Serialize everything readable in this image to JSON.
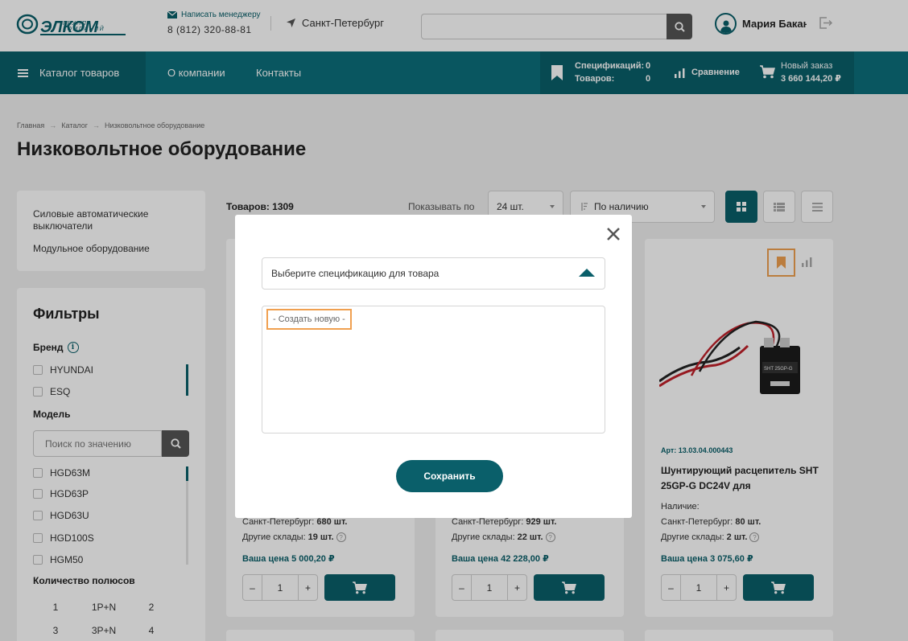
{
  "header": {
    "logo_sub": "ГРУППА КОМПАНИЙ",
    "logo_text": "ЭЛКОМ",
    "write_manager": "Написать менеджеру",
    "phone": "8 (812) 320-88-81",
    "city": "Санкт-Петербург",
    "search_placeholder": "",
    "user_name": "Мария Бакан"
  },
  "nav": {
    "catalog": "Каталог товаров",
    "about": "О компании",
    "contacts": "Контакты",
    "spec_label": "Спецификаций:",
    "spec_value": "0",
    "goods_label": "Товаров:",
    "goods_value": "0",
    "compare": "Сравнение",
    "new_order": "Новый заказ",
    "order_sum": "3 660 144,20 ₽"
  },
  "breadcrumb": [
    "Главная",
    "Каталог",
    "Низковольтное оборудование"
  ],
  "page_title": "Низковольтное оборудование",
  "side_categories": [
    "Силовые автоматические выключатели",
    "Модульное оборудование"
  ],
  "filters": {
    "title": "Фильтры",
    "brand_label": "Бренд",
    "brands": [
      "HYUNDAI",
      "ESQ"
    ],
    "model_label": "Модель",
    "model_search_placeholder": "Поиск по значению",
    "models": [
      "HGD63M",
      "HGD63P",
      "HGD63U",
      "HGD100S",
      "HGM50"
    ],
    "poles_label": "Количество полюсов",
    "poles": [
      "1",
      "1P+N",
      "2",
      "3",
      "3P+N",
      "4"
    ]
  },
  "toolbar": {
    "count": "Товаров: 1309",
    "show_by": "Показывать по",
    "per_page": "24 шт.",
    "sort": "По наличию"
  },
  "cards": [
    {
      "stock_spb": "680 шт.",
      "stock_other": "19 шт.",
      "price": "Ваша цена 5 000,20 ₽",
      "qty": "1"
    },
    {
      "stock_spb": "929 шт.",
      "stock_other": "22 шт.",
      "price": "Ваша цена 42 228,00 ₽",
      "qty": "1"
    },
    {
      "art": "Арт: 13.03.04.000443",
      "name": "Шунтирующий расцепитель SHT 25GP-G DC24V для",
      "availability": "Наличие:",
      "stock_spb": "80 шт.",
      "stock_other": "2 шт.",
      "price": "Ваша цена 3 075,60 ₽",
      "qty": "1"
    }
  ],
  "labels": {
    "spb": "Санкт-Петербург:",
    "other": "Другие склады:",
    "minus": "–",
    "plus": "+",
    "q": "?"
  },
  "modal": {
    "select_placeholder": "Выберите спецификацию для товара",
    "option_create": "- Создать новую -",
    "save": "Сохранить"
  },
  "colors": {
    "brand_dark": "#0a5f6a",
    "brand": "#0c6f7b",
    "highlight": "#f0a050"
  }
}
